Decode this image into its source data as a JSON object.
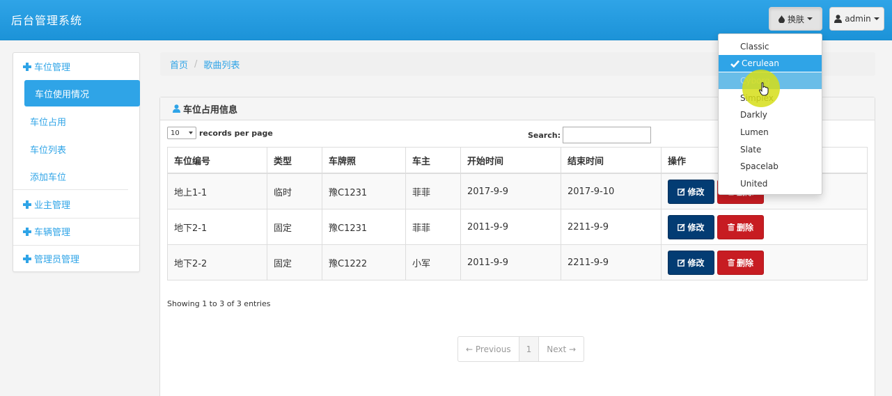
{
  "app": {
    "title": "后台管理系统",
    "skin_label": "换肤",
    "user_label": "admin"
  },
  "sidebar": {
    "groups": [
      {
        "label": "车位管理"
      },
      {
        "label": "业主管理"
      },
      {
        "label": "车辆管理"
      },
      {
        "label": "管理员管理"
      }
    ],
    "items": [
      {
        "label": "车位使用情况",
        "active": true
      },
      {
        "label": "车位占用"
      },
      {
        "label": "车位列表"
      },
      {
        "label": "添加车位"
      }
    ]
  },
  "breadcrumb": {
    "home": "首页",
    "current": "歌曲列表"
  },
  "panel": {
    "title": "车位占用信息",
    "length_value": "10",
    "length_suffix": "records per page",
    "search_label": "Search:",
    "search_value": "",
    "columns": [
      "车位编号",
      "类型",
      "车牌照",
      "车主",
      "开始时间",
      "结束时间",
      "操作"
    ],
    "rows": [
      [
        "地上1-1",
        "临时",
        "豫C1231",
        "菲菲",
        "2017-9-9",
        "2017-9-10"
      ],
      [
        "地下2-1",
        "固定",
        "豫C1231",
        "菲菲",
        "2011-9-9",
        "2211-9-9"
      ],
      [
        "地下2-2",
        "固定",
        "豫C1222",
        "小军",
        "2011-9-9",
        "2211-9-9"
      ]
    ],
    "edit_label": "修改",
    "delete_label": "删除",
    "info": "Showing 1 to 3 of 3 entries",
    "pager": {
      "previous": "← Previous",
      "page": "1",
      "next": "Next →"
    }
  },
  "skin_menu": {
    "options": [
      "Classic",
      "Cerulean",
      "Cyborg",
      "Simplex",
      "Darkly",
      "Lumen",
      "Slate",
      "Spacelab",
      "United"
    ],
    "selected": "Cerulean",
    "hovered": "Cyborg"
  },
  "colors": {
    "primary": "#2fa4e7",
    "edit_button": "#033c73",
    "delete_button": "#c71c22",
    "highlight": "#d6de18"
  },
  "icons": {
    "skin": "tint-icon",
    "user": "user-icon",
    "group": "plus-icon",
    "edit": "edit-icon",
    "delete": "trash-icon",
    "selected": "check-icon"
  }
}
